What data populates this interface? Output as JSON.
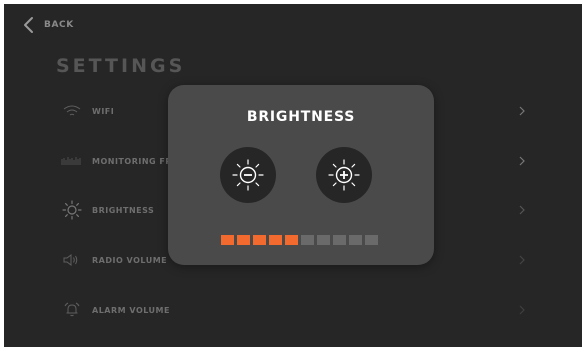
{
  "nav": {
    "back_label": "BACK"
  },
  "page": {
    "title": "SETTINGS"
  },
  "menu": {
    "items": [
      {
        "label": "WIFI",
        "icon": "wifi-icon"
      },
      {
        "label": "MONITORING FR",
        "icon": "signal-bars-icon"
      },
      {
        "label": "BRIGHTNESS",
        "icon": "sun-icon"
      },
      {
        "label": "RADIO VOLUME",
        "icon": "speaker-icon"
      },
      {
        "label": "ALARM VOLUME",
        "icon": "alarm-bell-icon"
      }
    ]
  },
  "dialog": {
    "title": "BRIGHTNESS",
    "decrease_icon": "brightness-decrease-icon",
    "increase_icon": "brightness-increase-icon",
    "level": 5,
    "max_level": 10
  },
  "colors": {
    "background": "#262626",
    "modal": "#4a4a4a",
    "accent": "#f26a2e",
    "segment_off": "#6a6a6a"
  }
}
